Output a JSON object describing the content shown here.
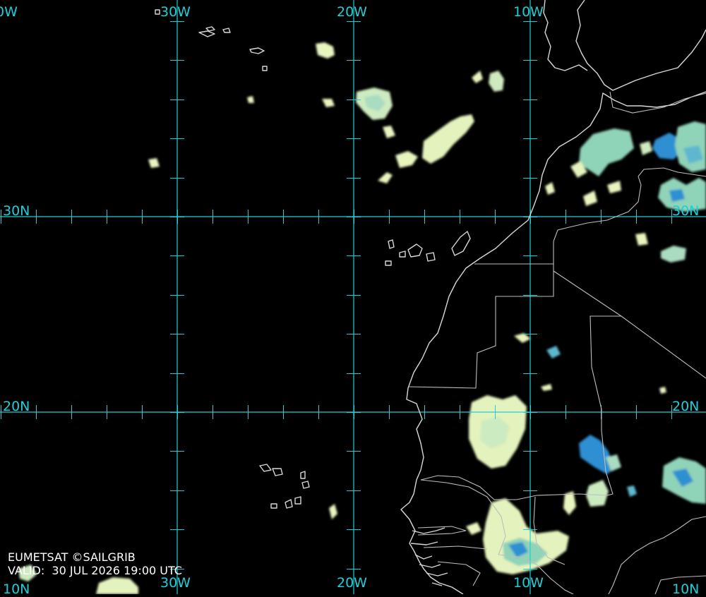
{
  "colors": {
    "grid": "#1ecfd8",
    "label": "#1ecfd8",
    "coast": "#d8d8d8",
    "border": "#bdbdbd",
    "cloud_light": "#e9f5bf",
    "cloud_mid": "#8fd3b8",
    "cloud_deep": "#2f8fd2",
    "background": "#000000"
  },
  "labels": {
    "top_30w": "30W",
    "top_20w": "20W",
    "top_10w": "10W",
    "top_40w_partial": "0W",
    "bottom_30w": "30W",
    "bottom_20w": "20W",
    "bottom_10w": "10W",
    "bottom_10n_left": "10N",
    "bottom_10n_right": "10N",
    "left_30n": "30N",
    "left_20n": "20N",
    "right_30n": "30N",
    "right_20n": "20N"
  },
  "credit": {
    "line1": "EUMETSAT ©SAILGRIB",
    "line2": "VALID:  30 JUL 2026 19:00 UTC"
  }
}
